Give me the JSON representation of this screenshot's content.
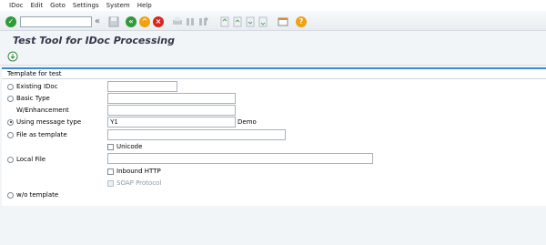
{
  "menu": [
    "IDoc",
    "Edit",
    "Goto",
    "Settings",
    "System",
    "Help"
  ],
  "toolbar": {
    "command_field_value": "",
    "icons": [
      "check-icon",
      "collapse-icon",
      "save-icon",
      "back-icon",
      "exit-icon",
      "cancel-icon",
      "print-icon",
      "find-icon",
      "find-next-icon",
      "first-page-icon",
      "prev-page-icon",
      "next-page-icon",
      "last-page-icon",
      "new-session-icon",
      "help-icon"
    ]
  },
  "page_title": "Test Tool for IDoc Processing",
  "group_title": "Template for test",
  "options": {
    "existing_idoc": {
      "label": "Existing IDoc",
      "value": ""
    },
    "basic_type": {
      "label": "Basic Type",
      "value": ""
    },
    "w_enhancement": {
      "label": "W/Enhancement",
      "value": ""
    },
    "using_message_type": {
      "label": "Using message type",
      "value": "Y1",
      "suffix": "Demo"
    },
    "file_as_template": {
      "label": "File as template",
      "value": ""
    },
    "unicode": {
      "label": "Unicode"
    },
    "local_file": {
      "label": "Local File",
      "value": ""
    },
    "inbound_http": {
      "label": "Inbound HTTP"
    },
    "soap_protocol": {
      "label": "SOAP Protocol"
    },
    "wo_template": {
      "label": "w/o template"
    }
  },
  "colors": {
    "accent": "#3d8bd0",
    "title": "#32384a"
  }
}
